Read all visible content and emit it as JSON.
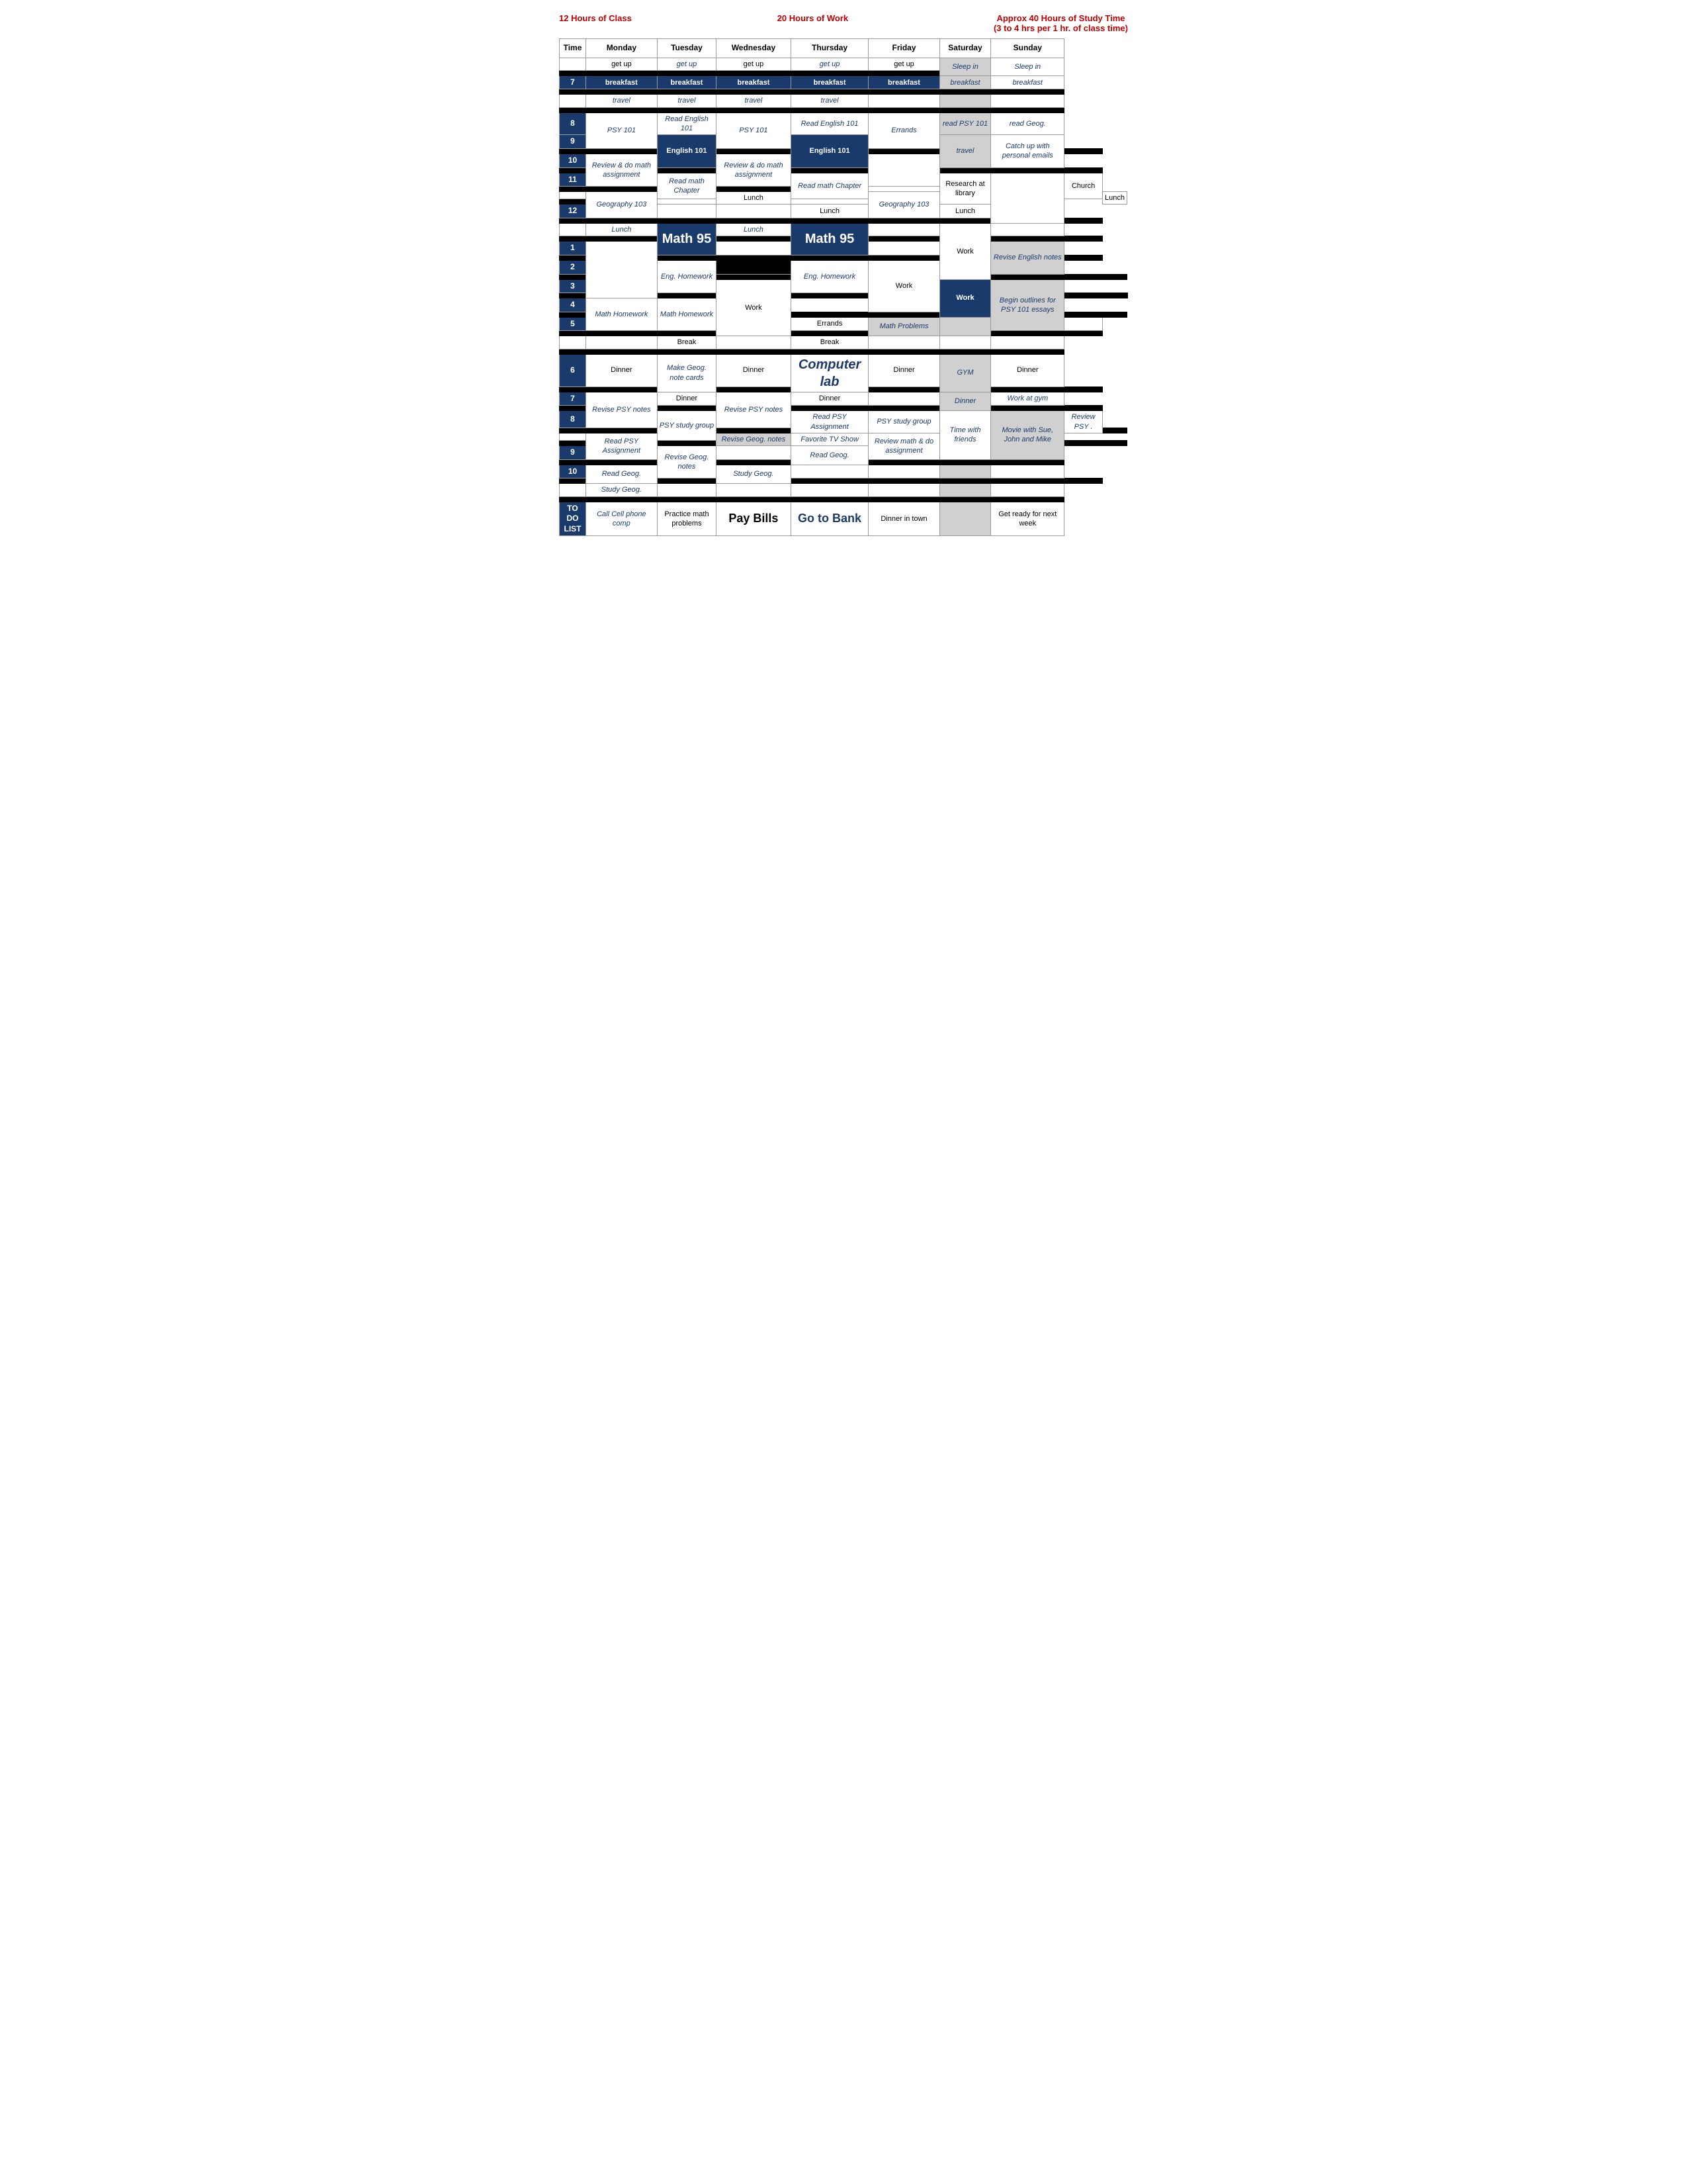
{
  "headers": {
    "col1": {
      "text": "12 Hours of Class",
      "color": "#c00000"
    },
    "col2": {
      "text": "20 Hours of Work",
      "color": "#c00000"
    },
    "col3_line1": "Approx 40 Hours of Study Time",
    "col3_line2": "(3 to 4 hrs per 1 hr. of class time)",
    "col3_color": "#c00000"
  },
  "table": {
    "columns": [
      "Time",
      "Monday",
      "Tuesday",
      "Wednesday",
      "Thursday",
      "Friday",
      "Saturday",
      "Sunday"
    ]
  }
}
